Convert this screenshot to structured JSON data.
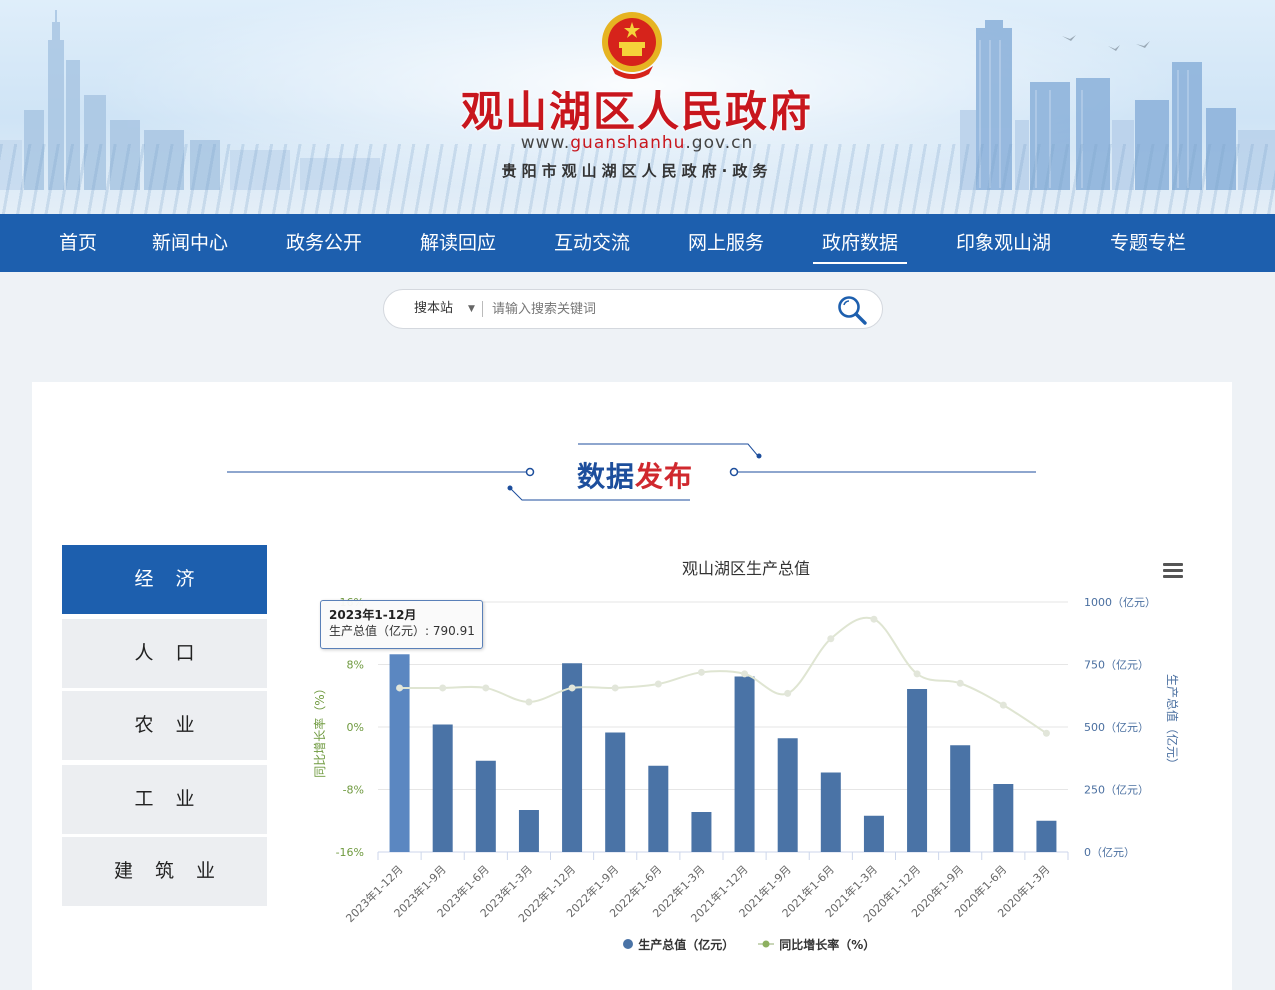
{
  "header": {
    "site_title": "观山湖区人民政府",
    "url_prefix": "www.",
    "url_highlight": "guanshanhu",
    "url_suffix": ".gov.cn",
    "subtitle": "贵阳市观山湖区人民政府·政务"
  },
  "nav": {
    "items": [
      "首页",
      "新闻中心",
      "政务公开",
      "解读回应",
      "互动交流",
      "网上服务",
      "政府数据",
      "印象观山湖",
      "专题专栏"
    ],
    "active": "政府数据"
  },
  "search": {
    "scope": "搜本站",
    "placeholder": "请输入搜索关键词"
  },
  "section": {
    "title_a": "数据",
    "title_b": "发布"
  },
  "side_tabs": [
    "经济",
    "人口",
    "农业",
    "工业",
    "建筑业"
  ],
  "active_tab": "经济",
  "tooltip": {
    "title": "2023年1-12月",
    "line": "生产总值（亿元）: 790.91"
  },
  "colors": {
    "nav_bg": "#1d5fae",
    "bar": "#4a73a6",
    "bar_highlight": "#5b87c1",
    "line": "#dfe5d2",
    "line_marker": "#e2e6da",
    "left_axis": "#6f9a3f",
    "right_axis": "#4a6fa0",
    "title_red": "#c8161d"
  },
  "chart_data": {
    "type": "bar",
    "title": "观山湖区生产总值",
    "categories": [
      "2023年1-12月",
      "2023年1-9月",
      "2023年1-6月",
      "2023年1-3月",
      "2022年1-12月",
      "2022年1-9月",
      "2022年1-6月",
      "2022年1-3月",
      "2021年1-12月",
      "2021年1-9月",
      "2021年1-6月",
      "2021年1-3月",
      "2020年1-12月",
      "2020年1-9月",
      "2020年1-6月",
      "2020年1-3月"
    ],
    "series": [
      {
        "name": "生产总值（亿元）",
        "type": "bar",
        "axis": "right",
        "values": [
          790.91,
          510,
          365,
          168,
          755,
          478,
          345,
          160,
          702,
          455,
          318,
          145,
          652,
          427,
          272,
          125
        ]
      },
      {
        "name": "同比增长率（%）",
        "type": "line",
        "axis": "left",
        "values": [
          5.0,
          5.0,
          5.0,
          3.2,
          5.0,
          5.0,
          5.5,
          7.0,
          6.8,
          4.3,
          11.3,
          13.8,
          6.8,
          5.6,
          2.8,
          -0.8
        ]
      }
    ],
    "left_axis": {
      "label": "同比增长率（%）",
      "ticks": [
        "-16%",
        "-8%",
        "0%",
        "8%",
        "16%"
      ],
      "range": [
        -16,
        16
      ]
    },
    "right_axis": {
      "label": "生产总值（亿元）",
      "ticks": [
        "0（亿元）",
        "250（亿元）",
        "500（亿元）",
        "750（亿元）",
        "1000（亿元）"
      ],
      "range": [
        0,
        1000
      ]
    },
    "legend": [
      "生产总值（亿元）",
      "同比增长率（%）"
    ],
    "legend_position": "bottom",
    "grid": true,
    "highlighted_index": 0
  }
}
